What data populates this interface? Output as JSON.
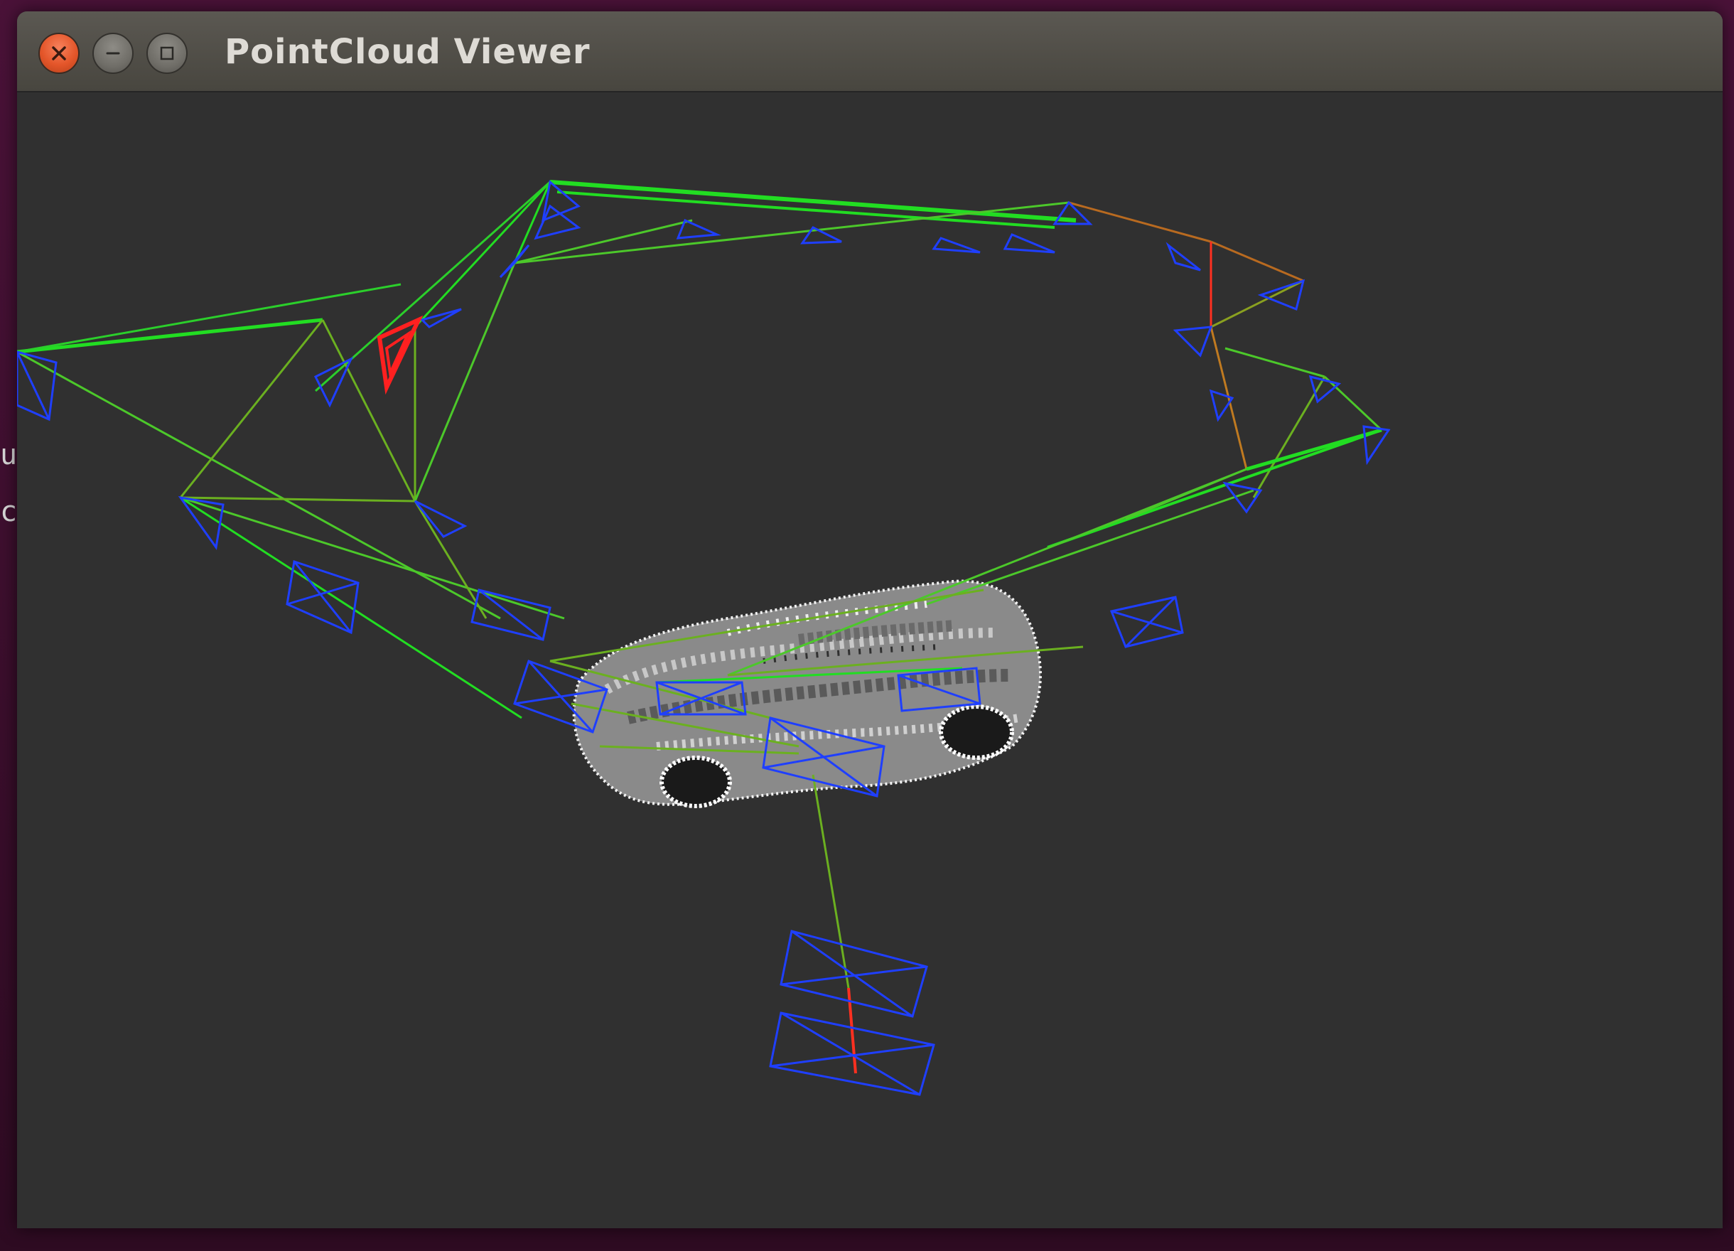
{
  "background_terminal": {
    "glyphs": [
      "u",
      "c"
    ]
  },
  "window": {
    "title": "PointCloud Viewer",
    "controls": {
      "close": "close-icon",
      "minimize": "minimize-icon",
      "maximize": "maximize-icon"
    }
  },
  "viewport": {
    "background_color": "#303030",
    "camera_frustum_color": "#1f3fff",
    "current_camera_color": "#ff2020",
    "graph_edge_colors": [
      "#22dd22",
      "#6bb020",
      "#b86a20",
      "#ff3020"
    ],
    "point_cloud_subject": "car"
  }
}
